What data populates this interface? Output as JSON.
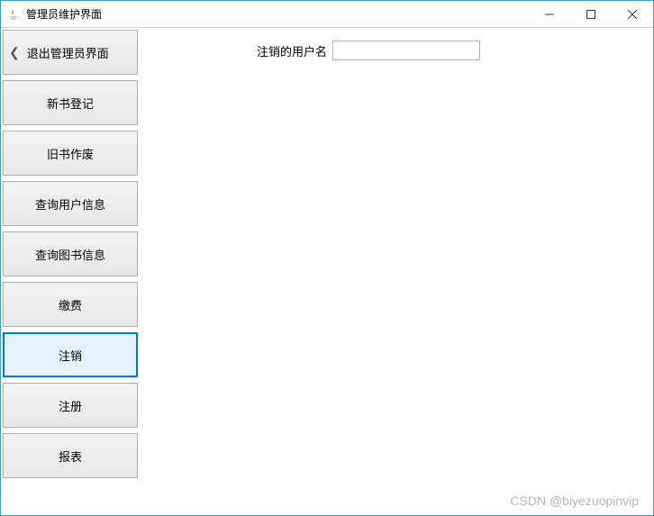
{
  "window": {
    "title": "管理员维护界面"
  },
  "sidebar": {
    "items": [
      {
        "label": "退出管理员界面",
        "has_back": true
      },
      {
        "label": "新书登记"
      },
      {
        "label": "旧书作废"
      },
      {
        "label": "查询用户信息"
      },
      {
        "label": "查询图书信息"
      },
      {
        "label": "缴费"
      },
      {
        "label": "注销",
        "selected": true
      },
      {
        "label": "注册"
      },
      {
        "label": "报表"
      }
    ]
  },
  "main": {
    "form_label": "注销的用户名",
    "form_value": ""
  },
  "watermark": "CSDN @biyezuopinvip"
}
